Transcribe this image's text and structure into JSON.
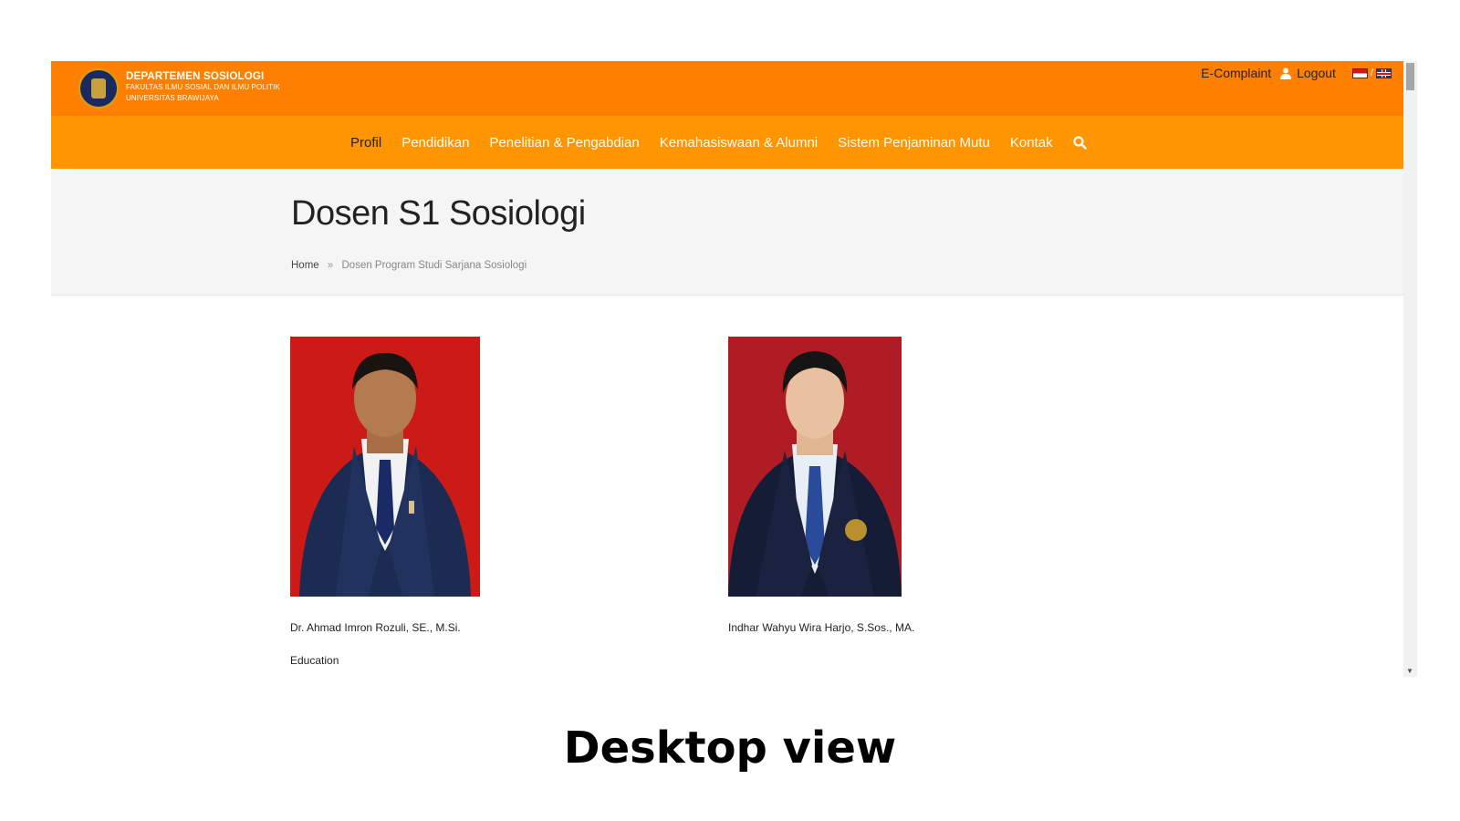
{
  "brand": {
    "title": "DEPARTEMEN SOSIOLOGI",
    "subtitle1": "FAKULTAS ILMU SOSIAL DAN ILMU POLITIK",
    "subtitle2": "UNIVERSITAS BRAWIJAYA"
  },
  "toplinks": {
    "ecomplaint": "E-Complaint",
    "logout": "Logout",
    "flag_separator": "/"
  },
  "nav": {
    "items": [
      "Profil",
      "Pendidikan",
      "Penelitian & Pengabdian",
      "Kemahasiswaan & Alumni",
      "Sistem Penjaminan Mutu",
      "Kontak"
    ],
    "active": "Profil"
  },
  "page": {
    "title": "Dosen S1 Sosiologi",
    "breadcrumb": {
      "home": "Home",
      "separator": "»",
      "current": "Dosen Program Studi Sarjana Sosiologi"
    }
  },
  "lecturers": [
    {
      "name": "Dr. Ahmad Imron Rozuli, SE., M.Si."
    },
    {
      "name": "Indhar Wahyu Wira Harjo, S.Sos., MA."
    }
  ],
  "section_label": "Education",
  "caption": "Desktop view",
  "colors": {
    "topbar": "#ff8000",
    "navbar": "#ff9500"
  }
}
